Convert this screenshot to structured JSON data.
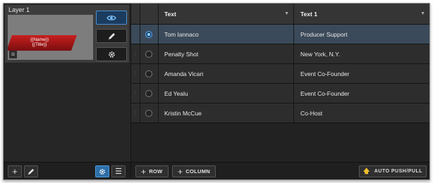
{
  "layer": {
    "title": "Layer 1",
    "thumbnail": {
      "line1": "{{Name}}",
      "line2": "{{Title}}"
    }
  },
  "icons": {
    "visibility": "eye-icon",
    "edit": "pencil-icon",
    "settings": "gear-icon",
    "menu": "list-icon",
    "add": "plus-icon",
    "push": "arrow-up-icon"
  },
  "colors": {
    "accent": "#4a8fd1",
    "selected_row": "#3b4a5a",
    "push_icon": "#f2c12e"
  },
  "table": {
    "columns": [
      "Text",
      "Text 1"
    ],
    "rows": [
      {
        "text": "Tom Iannaco",
        "text1": "Producer Support",
        "selected": true
      },
      {
        "text": "Penalty Shot",
        "text1": "New York, N.Y.",
        "selected": false
      },
      {
        "text": "Amanda Vicari",
        "text1": "Event Co-Founder",
        "selected": false
      },
      {
        "text": "Ed Yealu",
        "text1": "Event Co-Founder",
        "selected": false
      },
      {
        "text": "Kristin McCue",
        "text1": "Co-Host",
        "selected": false
      }
    ]
  },
  "toolbar": {
    "add_row": "ROW",
    "add_column": "COLUMN",
    "auto_push": "AUTO PUSH/PULL"
  }
}
